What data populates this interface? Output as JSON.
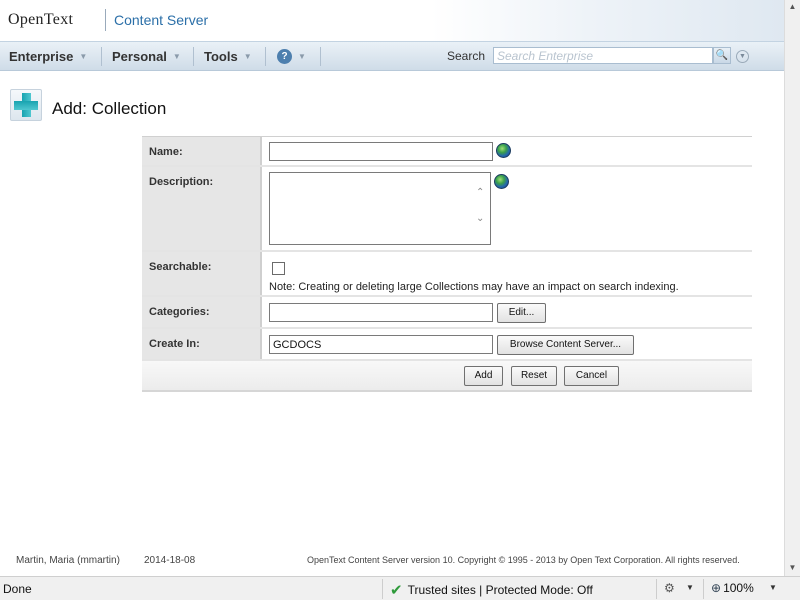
{
  "brand": {
    "logo_text": "OpenText",
    "product": "Content Server"
  },
  "nav": {
    "items": [
      {
        "label": "Enterprise"
      },
      {
        "label": "Personal"
      },
      {
        "label": "Tools"
      }
    ],
    "help_glyph": "?",
    "search_label": "Search",
    "search_placeholder": "Search Enterprise"
  },
  "page": {
    "title": "Add: Collection"
  },
  "form": {
    "name_label": "Name:",
    "name_value": "",
    "description_label": "Description:",
    "description_value": "",
    "searchable_label": "Searchable:",
    "searchable_checked": false,
    "searchable_note": "Note: Creating or deleting large Collections may have an impact on search indexing.",
    "categories_label": "Categories:",
    "categories_value": "",
    "edit_button": "Edit...",
    "create_in_label": "Create In:",
    "create_in_value": "GCDOCS",
    "browse_button": "Browse Content Server...",
    "add_button": "Add",
    "reset_button": "Reset",
    "cancel_button": "Cancel"
  },
  "footer": {
    "user": "Martin, Maria (mmartin)",
    "date": "2014-18-08",
    "copyright": "OpenText Content Server version 10. Copyright © 1995 - 2013 by Open Text Corporation. All rights reserved."
  },
  "statusbar": {
    "status": "Done",
    "zone": "Trusted sites | Protected Mode: Off",
    "zoom": "100%"
  },
  "icons": [
    "plus-icon",
    "globe-icon",
    "help-icon",
    "search-icon",
    "checkmark-icon",
    "magnifier-icon"
  ]
}
